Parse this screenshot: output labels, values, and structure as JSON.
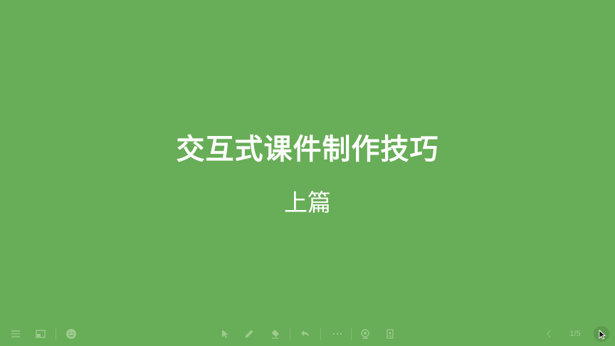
{
  "slide": {
    "title": "交互式课件制作技巧",
    "subtitle": "上篇",
    "background_color": "#68ad57",
    "text_color": "#ffffff"
  },
  "toolbar": {
    "icon_color": "#9ccc8e",
    "left_icons": [
      "menu-icon",
      "layout-icon",
      "emoji-icon"
    ],
    "center_icons": [
      "pointer-icon",
      "pen-icon",
      "eraser-icon",
      "undo-icon",
      "more-icon",
      "camera-icon",
      "screen-icon"
    ],
    "right_icons": [
      "prev-page-icon",
      "next-page-icon"
    ],
    "page_indicator": "1/5"
  }
}
